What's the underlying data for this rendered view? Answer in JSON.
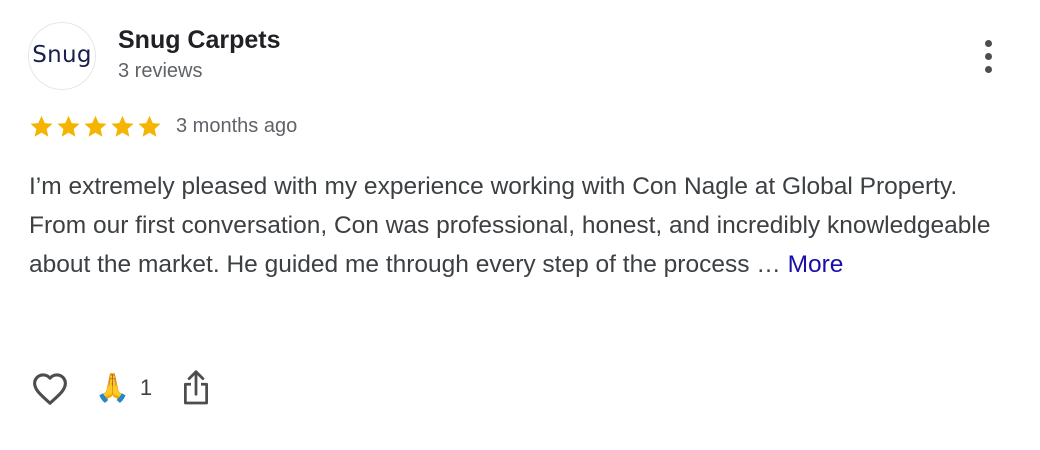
{
  "review": {
    "author": {
      "avatar_text": "Snug",
      "name": "Snug Carpets",
      "review_count": "3 reviews"
    },
    "rating": 5,
    "rating_max": 5,
    "star_color": "#f4b400",
    "timestamp": "3 months ago",
    "text": "I’m extremely pleased with my experience working with Con Nagle at Global Property. From our first conversation, Con was professional, honest, and incredibly knowledgeable about the market. He guided me through every step of the process … ",
    "more_label": "More",
    "more_color": "#1a0dab"
  },
  "actions": {
    "like_icon": "heart-outline-icon",
    "reaction_emoji": "🙏",
    "reaction_count": "1",
    "share_icon": "share-icon"
  },
  "menu": {
    "icon": "more-vertical-icon"
  }
}
